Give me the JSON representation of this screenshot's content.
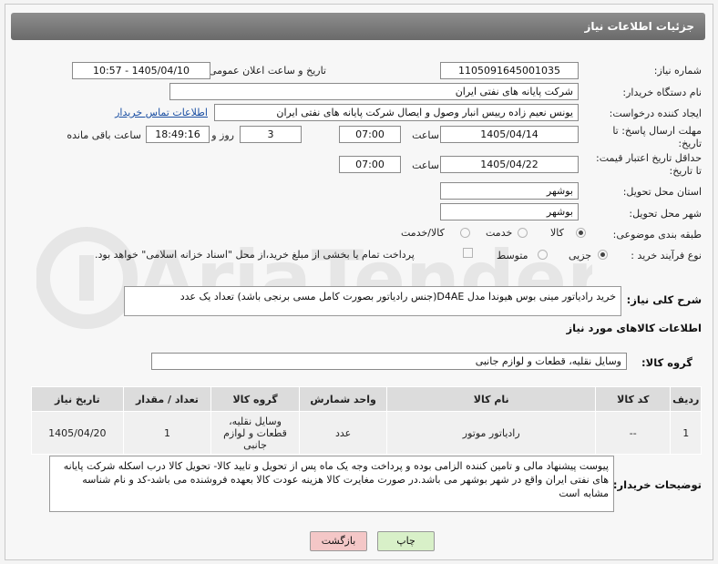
{
  "header": {
    "title": "جزئیات اطلاعات نیاز"
  },
  "form": {
    "need_number_label": "شماره نیاز:",
    "need_number": "1105091645001035",
    "announce_label": "تاریخ و ساعت اعلان عمومی:",
    "announce_value": "1405/04/10 - 10:57",
    "buyer_org_label": "نام دستگاه خریدار:",
    "buyer_org": "شرکت پایانه های نفتی ایران",
    "creator_label": "ایجاد کننده درخواست:",
    "creator": "یونس نعیم زاده رییس انبار وصول و ایصال شرکت پایانه های نفتی ایران",
    "contact_link": "اطلاعات تماس خریدار",
    "deadline_label_1": "مهلت ارسال پاسخ: تا",
    "deadline_label_2": "تاریخ:",
    "deadline_date": "1405/04/14",
    "time_label": "ساعت",
    "deadline_time": "07:00",
    "days_value": "3",
    "days_label": "روز و",
    "remaining_time": "18:49:16",
    "remaining_label": "ساعت باقی مانده",
    "validity_label_1": "حداقل تاریخ اعتبار قیمت:",
    "validity_label_2": "تا تاریخ:",
    "validity_date": "1405/04/22",
    "validity_time": "07:00",
    "province_label": "استان محل تحویل:",
    "province": "بوشهر",
    "city_label": "شهر محل تحویل:",
    "city": "بوشهر",
    "category_label": "طبقه بندی موضوعی:",
    "category_options": [
      "کالا",
      "خدمت",
      "کالا/خدمت"
    ],
    "category_selected": "کالا",
    "process_label": "نوع فرآیند خرید :",
    "process_options": [
      "جزیی",
      "متوسط"
    ],
    "process_selected": "جزیی",
    "payment_note": "پرداخت تمام یا بخشی از مبلغ خرید،از محل \"اسناد خزانه اسلامی\" خواهد بود."
  },
  "description": {
    "label": "شرح کلی نیاز:",
    "text": "خرید رادیاتور مینی بوس هیوندا مدل D4AE(جنس رادیاتور بصورت کامل مسی برنجی باشد) تعداد یک عدد"
  },
  "goods": {
    "section_title": "اطلاعات کالاهای مورد نیاز",
    "group_label": "گروه کالا:",
    "group_value": "وسایل نقلیه، قطعات و لوازم جانبی",
    "columns": [
      "ردیف",
      "کد کالا",
      "نام کالا",
      "واحد شمارش",
      "گروه کالا",
      "تعداد / مقدار",
      "تاریخ نیاز"
    ],
    "rows": [
      [
        "1",
        "--",
        "رادیاتور موتور",
        "عدد",
        "وسایل نقلیه، قطعات و لوازم جانبی",
        "1",
        "1405/04/20"
      ]
    ]
  },
  "notes": {
    "label": "توضیحات خریدار:",
    "text": "پیوست پیشنهاد مالی و تامین کننده الزامی بوده و پرداخت وجه یک ماه پس از تحویل و تایید کالا- تحویل کالا درب اسکله شرکت پایانه های نفتی ایران واقع در شهر بوشهر می باشد.در صورت مغایرت کالا هزینه عودت کالا بعهده فروشنده می باشد-کد و نام شناسه مشابه است"
  },
  "buttons": {
    "print": "چاپ",
    "back": "بازگشت"
  },
  "watermark": "AriaTender.net",
  "colors": {
    "header": "#7a7a7a",
    "print_button": "#d8f0c8",
    "back_button": "#f4c7c7",
    "link": "#1a4fa3"
  }
}
